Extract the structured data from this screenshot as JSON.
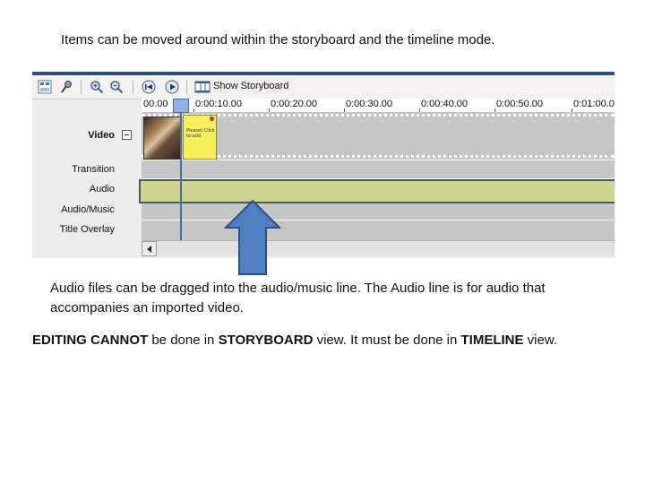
{
  "heading": "Items can be moved around within the storyboard and the timeline mode.",
  "toolbar": {
    "show_storyboard_label": "Show Storyboard",
    "icons": [
      "storyboard-view-icon",
      "microphone-icon",
      "zoom-in-icon",
      "zoom-out-icon",
      "rewind-icon",
      "play-icon",
      "filmstrip-icon"
    ]
  },
  "ruler": {
    "ticks": [
      "00.00",
      "0:00:10.00",
      "0:00:20.00",
      "0:00:30.00",
      "0:00:40.00",
      "0:00:50.00",
      "0:01:00.0"
    ]
  },
  "tracks": {
    "video": "Video",
    "transition": "Transition",
    "audio": "Audio",
    "audio_music": "Audio/Music",
    "title_overlay": "Title Overlay"
  },
  "clips": {
    "note_text": "Pleaset Click to add"
  },
  "captions": {
    "audio_note": "Audio  files can  be dragged into the audio/music line. The Audio line is for audio that accompanies an imported video.",
    "editing_1": "EDITING CANNOT",
    "editing_2": " be done in ",
    "editing_3": "STORYBOARD",
    "editing_4": " view.  It must be done in ",
    "editing_5": "TIMELINE",
    "editing_6": " view."
  },
  "colors": {
    "accent_bar": "#2a4f7e",
    "audio_highlight": "#d1d391",
    "arrow_fill": "#4f7fbf",
    "arrow_stroke": "#2c4f7d",
    "playhead": "#3e6fb0"
  }
}
